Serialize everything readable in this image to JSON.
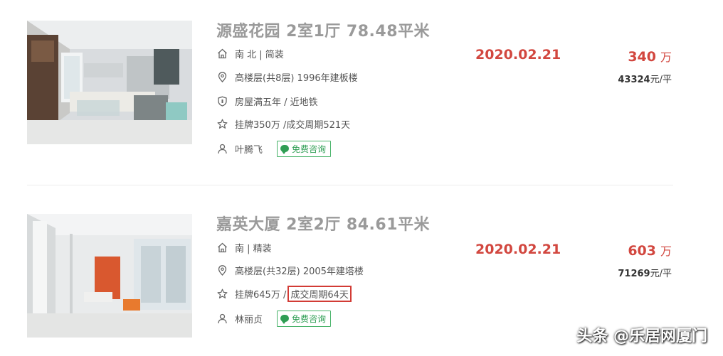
{
  "listings": [
    {
      "title": "源盛花园 2室1厅 78.48平米",
      "orientation": "南 北 | 简装",
      "floor": "高楼层(共8层) 1996年建板楼",
      "tags": "房屋满五年 / 近地铁",
      "listing_prefix": "挂牌350万 / ",
      "listing_cycle": "成交周期521天",
      "agent": "叶腾飞",
      "consult_label": "免费咨询",
      "date": "2020.02.21",
      "price": "340",
      "price_unit": "万",
      "unit_price_num": "43324",
      "unit_price_suffix": "元/平"
    },
    {
      "title": "嘉英大厦 2室2厅 84.61平米",
      "orientation": "南 | 精装",
      "floor": "高楼层(共32层) 2005年建塔楼",
      "listing_prefix": "挂牌645万 / ",
      "listing_cycle": "成交周期64天",
      "agent": "林丽贞",
      "consult_label": "免费咨询",
      "date": "2020.02.21",
      "price": "603",
      "price_unit": "万",
      "unit_price_num": "71269",
      "unit_price_suffix": "元/平"
    }
  ],
  "icons": {
    "home": "home-icon",
    "location": "location-pin-icon",
    "shield": "shield-icon",
    "star": "star-icon",
    "person": "person-icon",
    "chat": "chat-bubble-icon"
  },
  "colors": {
    "accent_red": "#d2473f",
    "title_gray": "#9a9a9a",
    "consult_green": "#2f9e54",
    "highlight_box": "#d23b35"
  },
  "watermark": "头条 @乐居网厦门"
}
